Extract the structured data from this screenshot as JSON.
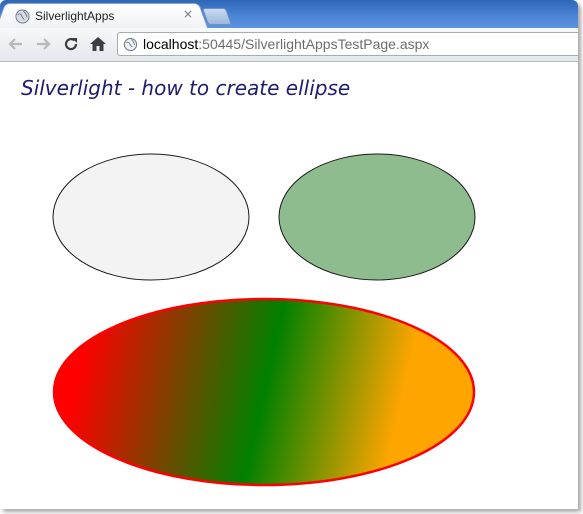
{
  "browser": {
    "tab": {
      "title": "SilverlightApps",
      "close_glyph": "×"
    },
    "toolbar": {
      "back_icon": "back-arrow-icon",
      "forward_icon": "forward-arrow-icon",
      "reload_icon": "reload-icon",
      "home_icon": "home-icon"
    },
    "address": {
      "host": "localhost",
      "rest": ":50445/SilverlightAppsTestPage.aspx"
    }
  },
  "page": {
    "title": "Silverlight - how to create ellipse"
  },
  "ellipses": {
    "top_left": {
      "fill": "#f3f3f3",
      "stroke": "#1a1a1a"
    },
    "top_right": {
      "fill": "#8fbc8f",
      "stroke": "#1a1a1a"
    },
    "bottom": {
      "stroke": "#ff0000",
      "gradient": [
        "#ff0000",
        "#008000",
        "#ffa500"
      ]
    }
  }
}
